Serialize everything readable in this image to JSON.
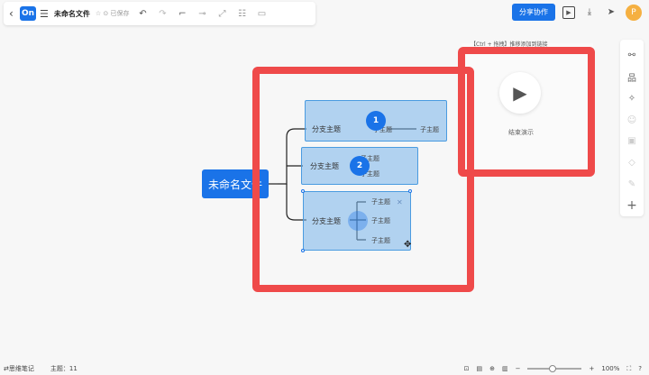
{
  "topbar": {
    "back_icon": "chevron-left-icon",
    "logo_text": "On",
    "menu_icon": "hamburger-menu-icon",
    "doc_title": "未命名文件",
    "saved_status": "☆ ⊙ 已保存",
    "tools": [
      "undo-icon",
      "redo-icon",
      "format-painter-icon",
      "insert-node-icon",
      "connector-icon",
      "summary-icon",
      "border-icon"
    ]
  },
  "topright": {
    "share_label": "分享协作",
    "avatar_text": "P"
  },
  "video": {
    "hint": "【Ctrl + 拖拽】推移添加到链接",
    "end_label": "结束演示"
  },
  "mindmap": {
    "root_label": "未命名文件",
    "branches": [
      {
        "label": "分支主题",
        "badge": "1",
        "subs": [
          "子主题",
          "子主题"
        ]
      },
      {
        "label": "分支主题",
        "badge": "2",
        "subs": [
          "子主题",
          "子主题"
        ]
      },
      {
        "label": "分支主题",
        "badge": "",
        "subs": [
          "子主题",
          "子主题",
          "子主题"
        ]
      }
    ]
  },
  "bottombar": {
    "mode_label": "⇄思维笔记",
    "topic_count": "主题：11",
    "zoom": "100%"
  },
  "colors": {
    "accent": "#1a73e8",
    "highlight": "#ef4a4a",
    "selection": "#78b4eb"
  }
}
